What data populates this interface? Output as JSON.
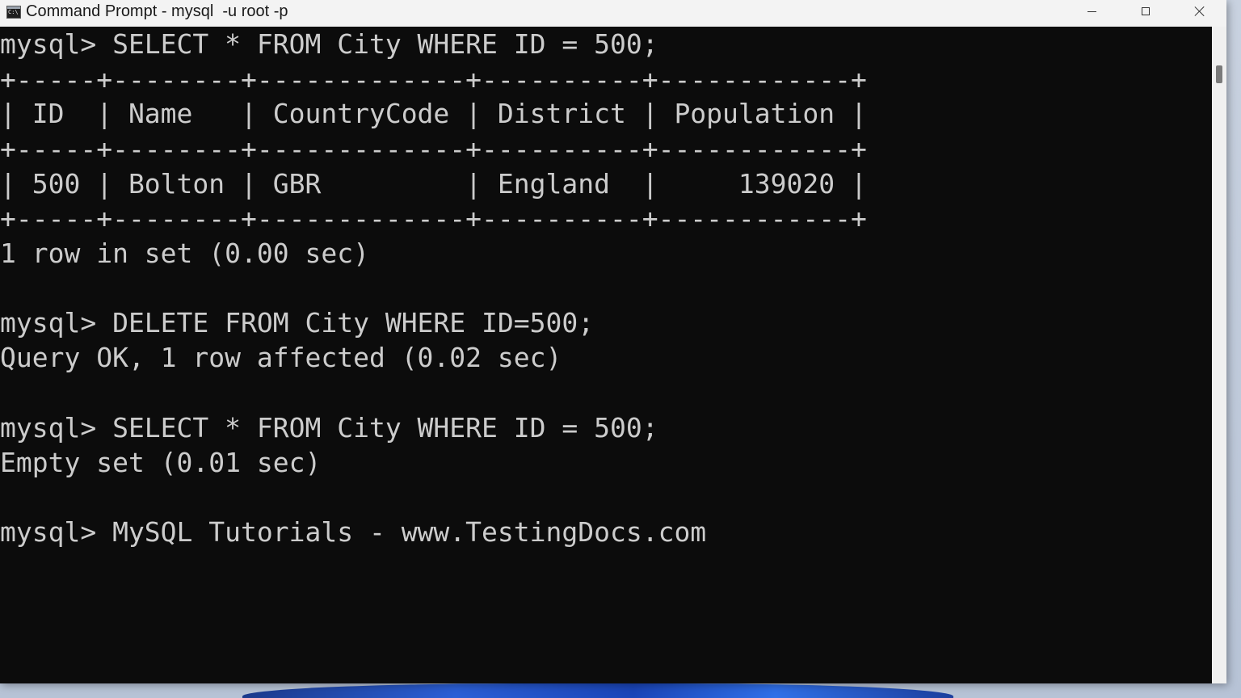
{
  "window": {
    "title": "Command Prompt - mysql  -u root -p",
    "icon": "cmd-icon",
    "buttons": {
      "minimize": "minimize-icon",
      "maximize": "maximize-icon",
      "close": "close-icon"
    }
  },
  "console": {
    "lines": [
      "mysql> SELECT * FROM City WHERE ID = 500;",
      "+-----+--------+-------------+----------+------------+",
      "| ID  | Name   | CountryCode | District | Population |",
      "+-----+--------+-------------+----------+------------+",
      "| 500 | Bolton | GBR         | England  |     139020 |",
      "+-----+--------+-------------+----------+------------+",
      "1 row in set (0.00 sec)",
      "",
      "mysql> DELETE FROM City WHERE ID=500;",
      "Query OK, 1 row affected (0.02 sec)",
      "",
      "mysql> SELECT * FROM City WHERE ID = 500;",
      "Empty set (0.01 sec)",
      "",
      "mysql> MySQL Tutorials - www.TestingDocs.com"
    ]
  },
  "colors": {
    "console_bg": "#0c0c0c",
    "console_text": "#cccccc",
    "titlebar_bg": "#f3f3f3"
  }
}
